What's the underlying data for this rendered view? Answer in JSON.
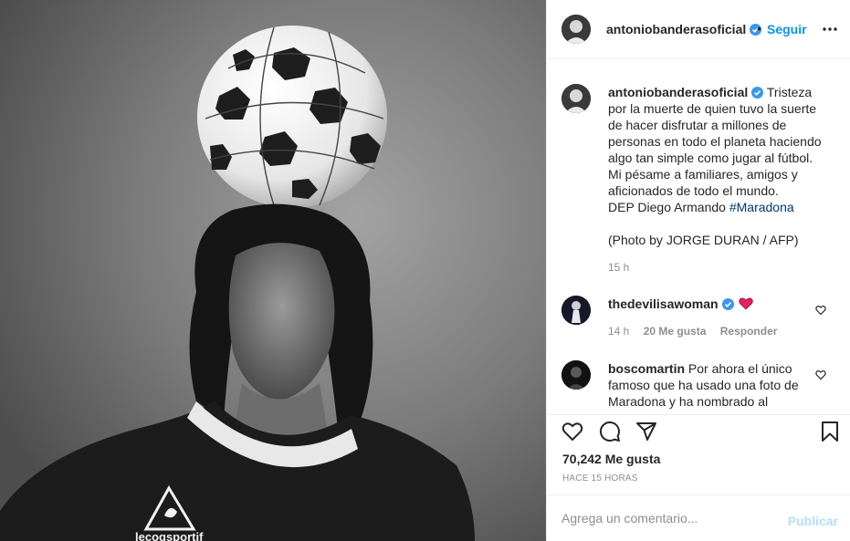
{
  "colors": {
    "accent": "#0095f6",
    "verified": "#3897f0",
    "hashtag": "#00376b",
    "muted": "#8e8e8e",
    "like_red": "#ed4956",
    "publish_disabled": "#b2dffc"
  },
  "photo": {
    "icons": [
      "soccer-ball",
      "player",
      "jersey-logo"
    ],
    "jersey_text": "lecoqsportif"
  },
  "header": {
    "username": "antoniobanderasoficial",
    "separator": "•",
    "follow_label": "Seguir",
    "icons": [
      "avatar",
      "verified-badge",
      "more-options-icon"
    ]
  },
  "caption": {
    "username": "antoniobanderasoficial",
    "text": "Tristeza por la muerte de quien tuvo la suerte de hacer disfrutar a millones de personas en todo el planeta haciendo algo tan simple como jugar al fútbol. Mi pésame a familiares, amigos y aficionados de todo el mundo.",
    "dep_text": "DEP Diego Armando ",
    "hashtag": "#Maradona",
    "credit": "(Photo by JORGE DURAN / AFP)",
    "time": "15 h"
  },
  "comments": [
    {
      "username": "thedevilisawoman",
      "verified": true,
      "text_icon": "red-heart",
      "time": "14 h",
      "likes": "20 Me gusta",
      "reply": "Responder"
    },
    {
      "username": "boscomartin",
      "verified": false,
      "text": "Por ahora el único famoso que ha usado una foto de Maradona y ha nombrado al"
    }
  ],
  "actions": {
    "icons": [
      "heart-icon",
      "comment-icon",
      "share-icon",
      "bookmark-icon"
    ],
    "likes": "70,242 Me gusta",
    "ago": "HACE 15 HORAS"
  },
  "add_comment": {
    "placeholder": "Agrega un comentario...",
    "publish_label": "Publicar"
  }
}
